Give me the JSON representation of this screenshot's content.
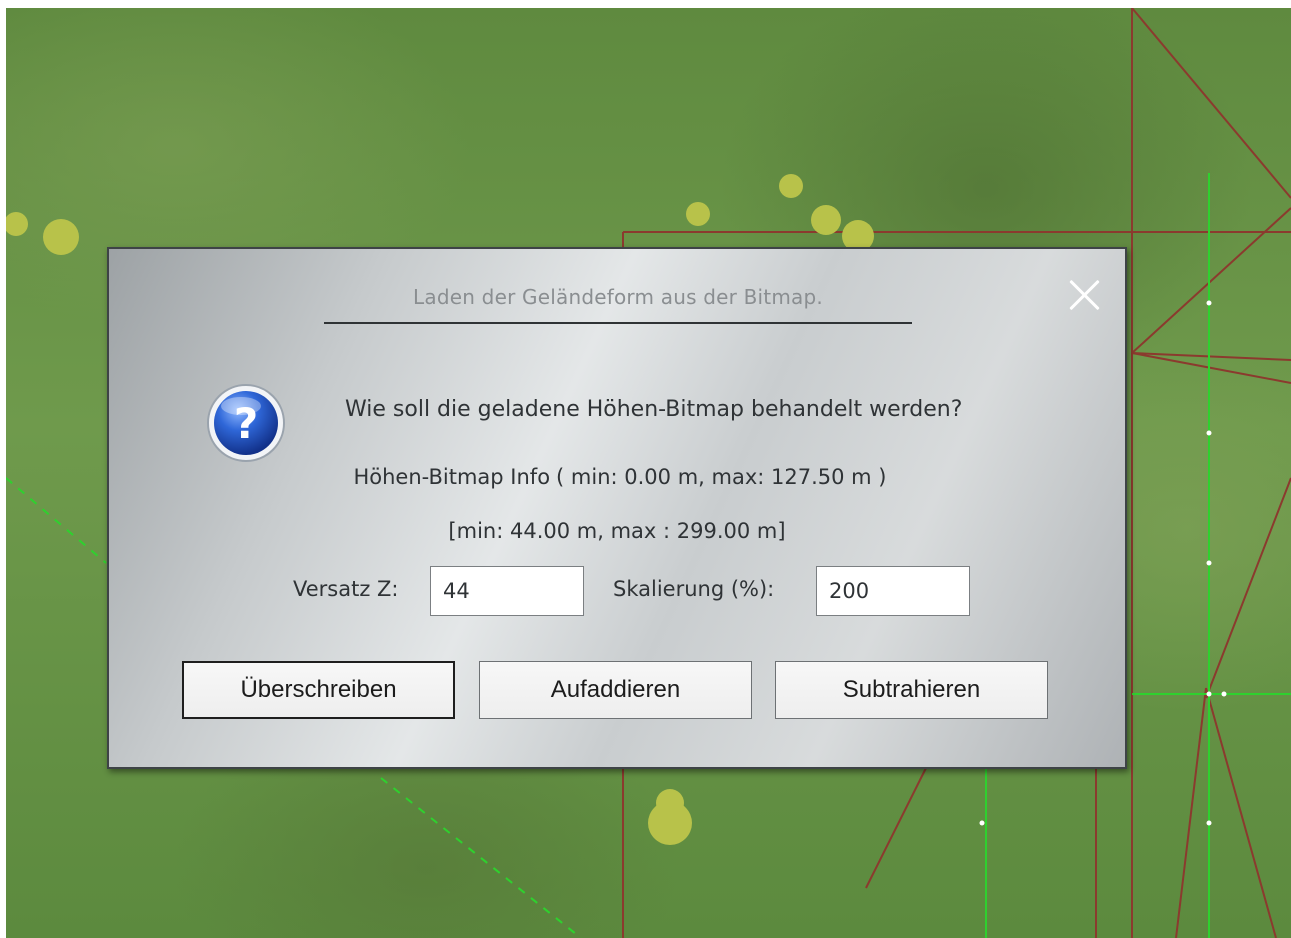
{
  "dialog": {
    "title": "Laden der Geländeform aus der Bitmap.",
    "close_icon": "close-icon",
    "question_icon": "question-icon",
    "question": "Wie soll die geladene Höhen-Bitmap behandelt werden?",
    "info_label": "Höhen-Bitmap Info",
    "info_range": "( min: 0.00 m, max: 127.50 m )",
    "result_range": "[min: 44.00 m, max :  299.00 m]",
    "offset_label": "Versatz Z:",
    "offset_value": "44",
    "scale_label": "Skalierung (%):",
    "scale_value": "200",
    "buttons": {
      "overwrite": "Überschreiben",
      "add": "Aufaddieren",
      "subtract": "Subtrahieren"
    }
  },
  "colors": {
    "terrain": "#6a9447",
    "vegetation": "#b8c24a",
    "grid_red": "#8b3a2e",
    "grid_green": "#2ed12e",
    "question_blue": "#1d55c4"
  }
}
